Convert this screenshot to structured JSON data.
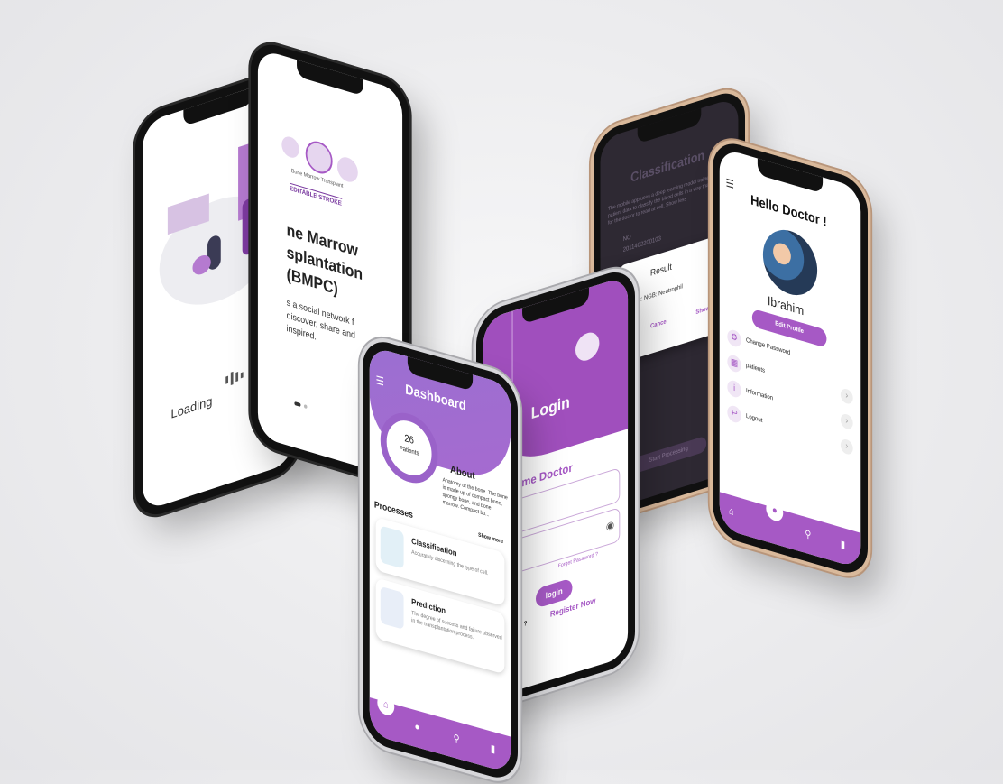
{
  "loading": {
    "label": "Loading"
  },
  "intro": {
    "diagram_label": "Bone Marrow Transplant",
    "stroke_label": "EDITABLE STROKE",
    "headline_1": "ne Marrow",
    "headline_2": "splantation",
    "headline_3": "(BMPC)",
    "body_1": "s a social network f",
    "body_2": "discover, share and",
    "body_3": "inspired."
  },
  "dashboard": {
    "title": "Dashboard",
    "menu_icon": "hamburger-icon",
    "patients_count": "26",
    "patients_label": "Patients",
    "about_title": "About",
    "about_text": "Anatomy of the bone. The bone is made up of compact bone, spongy bone, and bone marrow. Compact bo...",
    "show_more": "Show more",
    "processes_title": "Processes",
    "processes": [
      {
        "title": "Classification",
        "desc": "Accurately discerning the type of cell."
      },
      {
        "title": "Prediction",
        "desc": "The degree of success and failure observed in the transplantation process."
      }
    ],
    "nav": [
      "home-icon",
      "person-icon",
      "search-icon",
      "chart-icon"
    ]
  },
  "login": {
    "title": "Login",
    "welcome": "Welcome Doctor",
    "username_placeholder": "rName",
    "password_placeholder": "ssword",
    "forgot": "Forget Password ?",
    "login_button": "login",
    "no_account": "e an account ?",
    "register": "Register Now"
  },
  "classification": {
    "title": "Classification",
    "text": "The mobile app uses a deep learning model trained on patient data to classify the blood cells in a way that is easy for the doctor to read at cell. Show less",
    "id_label": "NO",
    "id_value": "2011402200103",
    "dialog_title": "Result",
    "dialog_status": "Status: NGB: Neutrophil",
    "dialog_cancel": "Cancel",
    "dialog_show": "Show in",
    "action_button": "Start Processing"
  },
  "profile": {
    "title": "Hello Doctor !",
    "name": "Ibrahim",
    "edit_button": "Edit Profile",
    "menu": [
      {
        "label": "Change Password",
        "icon": "settings-icon"
      },
      {
        "label": "patients",
        "icon": "patients-icon"
      },
      {
        "label": "Information",
        "icon": "info-icon"
      },
      {
        "label": "Logout",
        "icon": "logout-icon"
      }
    ],
    "nav": [
      "home-icon",
      "person-icon",
      "search-icon",
      "chart-icon"
    ]
  },
  "colors": {
    "accent": "#a659c5",
    "accent_light": "#9b6fd1",
    "background": "#ececee"
  }
}
